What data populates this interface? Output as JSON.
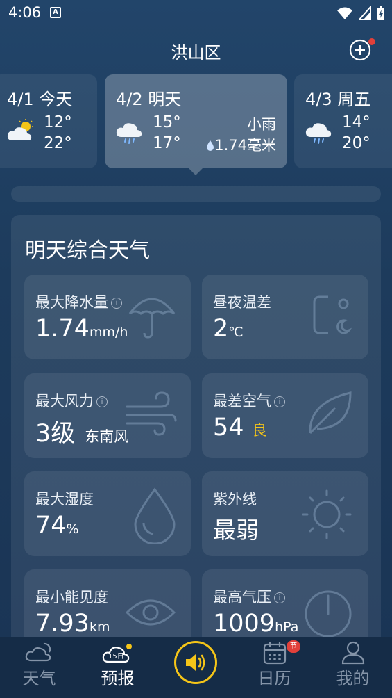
{
  "status": {
    "time": "4:06",
    "notif_icon": "A"
  },
  "header": {
    "title": "洪山区"
  },
  "days": [
    {
      "name": "4/1 今天",
      "lo": "12°",
      "hi": "22°",
      "icon": "partly-cloudy-icon"
    },
    {
      "name": "4/2 明天",
      "lo": "15°",
      "hi": "17°",
      "desc": "小雨",
      "rain": "1.74毫米",
      "icon": "rain-cloud-icon"
    },
    {
      "name": "4/3 周五",
      "lo": "14°",
      "hi": "20°",
      "icon": "rain-cloud-icon"
    }
  ],
  "panel": {
    "title": "明天综合天气"
  },
  "cards": {
    "precip": {
      "label": "最大降水量",
      "value": "1.74",
      "unit": "mm/h"
    },
    "tempdiff": {
      "label": "昼夜温差",
      "value": "2",
      "unit": "℃"
    },
    "wind": {
      "label": "最大风力",
      "value": "3级",
      "sub": "东南风"
    },
    "air": {
      "label": "最差空气",
      "value": "54",
      "sub": "良"
    },
    "humidity": {
      "label": "最大湿度",
      "value": "74",
      "unit": "%"
    },
    "uv": {
      "label": "紫外线",
      "value": "最弱"
    },
    "visibility": {
      "label": "最小能见度",
      "value": "7.93",
      "unit": "km"
    },
    "pressure": {
      "label": "最高气压",
      "value": "1009",
      "unit": "hPa"
    }
  },
  "tabs": [
    {
      "label": "天气",
      "icon": "weather-tab-icon"
    },
    {
      "label": "预报",
      "icon": "forecast-15day-icon",
      "icon_text": "15日"
    },
    {
      "label": "",
      "icon": "speaker-icon"
    },
    {
      "label": "日历",
      "icon": "calendar-icon",
      "badge": "节"
    },
    {
      "label": "我的",
      "icon": "user-icon"
    }
  ],
  "colors": {
    "accent": "#f5c518",
    "badge": "#e2403a",
    "aqi_good": "#f5c518"
  }
}
